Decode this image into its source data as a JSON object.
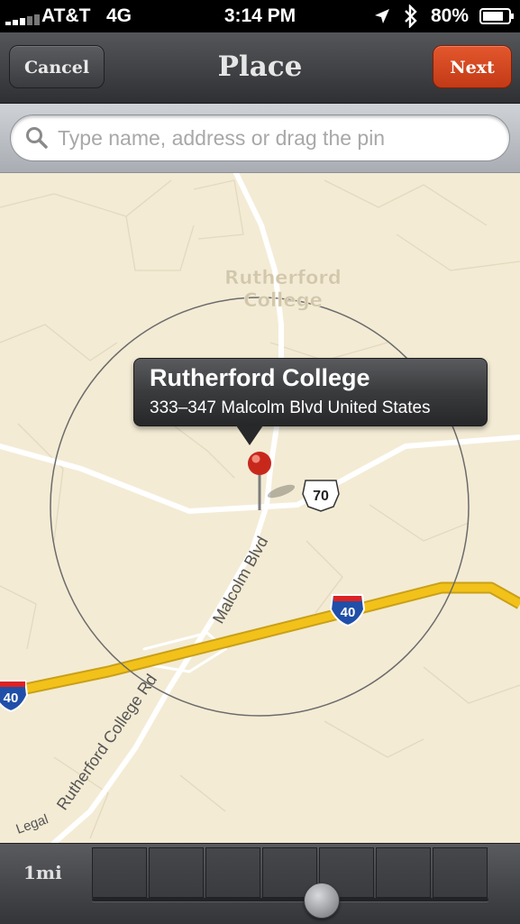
{
  "status_bar": {
    "carrier": "AT&T",
    "network": "4G",
    "time": "3:14 PM",
    "battery": "80%",
    "icons": [
      "signal-bars-icon",
      "location-arrow-icon",
      "bluetooth-icon",
      "battery-icon"
    ]
  },
  "nav": {
    "cancel_label": "Cancel",
    "title": "Place",
    "next_label": "Next"
  },
  "search": {
    "placeholder": "Type name, address or drag the pin",
    "value": ""
  },
  "map": {
    "town_label_line1": "Rutherford",
    "town_label_line2": "College",
    "road_malcolm": "Malcolm Blvd",
    "road_rutherford": "Rutherford College Rd",
    "road_partial": "Legal",
    "shield_us70": "70",
    "shield_i40_main": "40",
    "shield_i40_left": "40"
  },
  "callout": {
    "title": "Rutherford College",
    "subtitle": "333–347 Malcolm Blvd United States"
  },
  "bottom": {
    "scale_label": "1mi",
    "slider_level": 0.54
  },
  "colors": {
    "map_background": "#f3ebd4",
    "interstate": "#f2c21a",
    "next_button": "#d4461f",
    "nav_bar": "#3f4044"
  }
}
